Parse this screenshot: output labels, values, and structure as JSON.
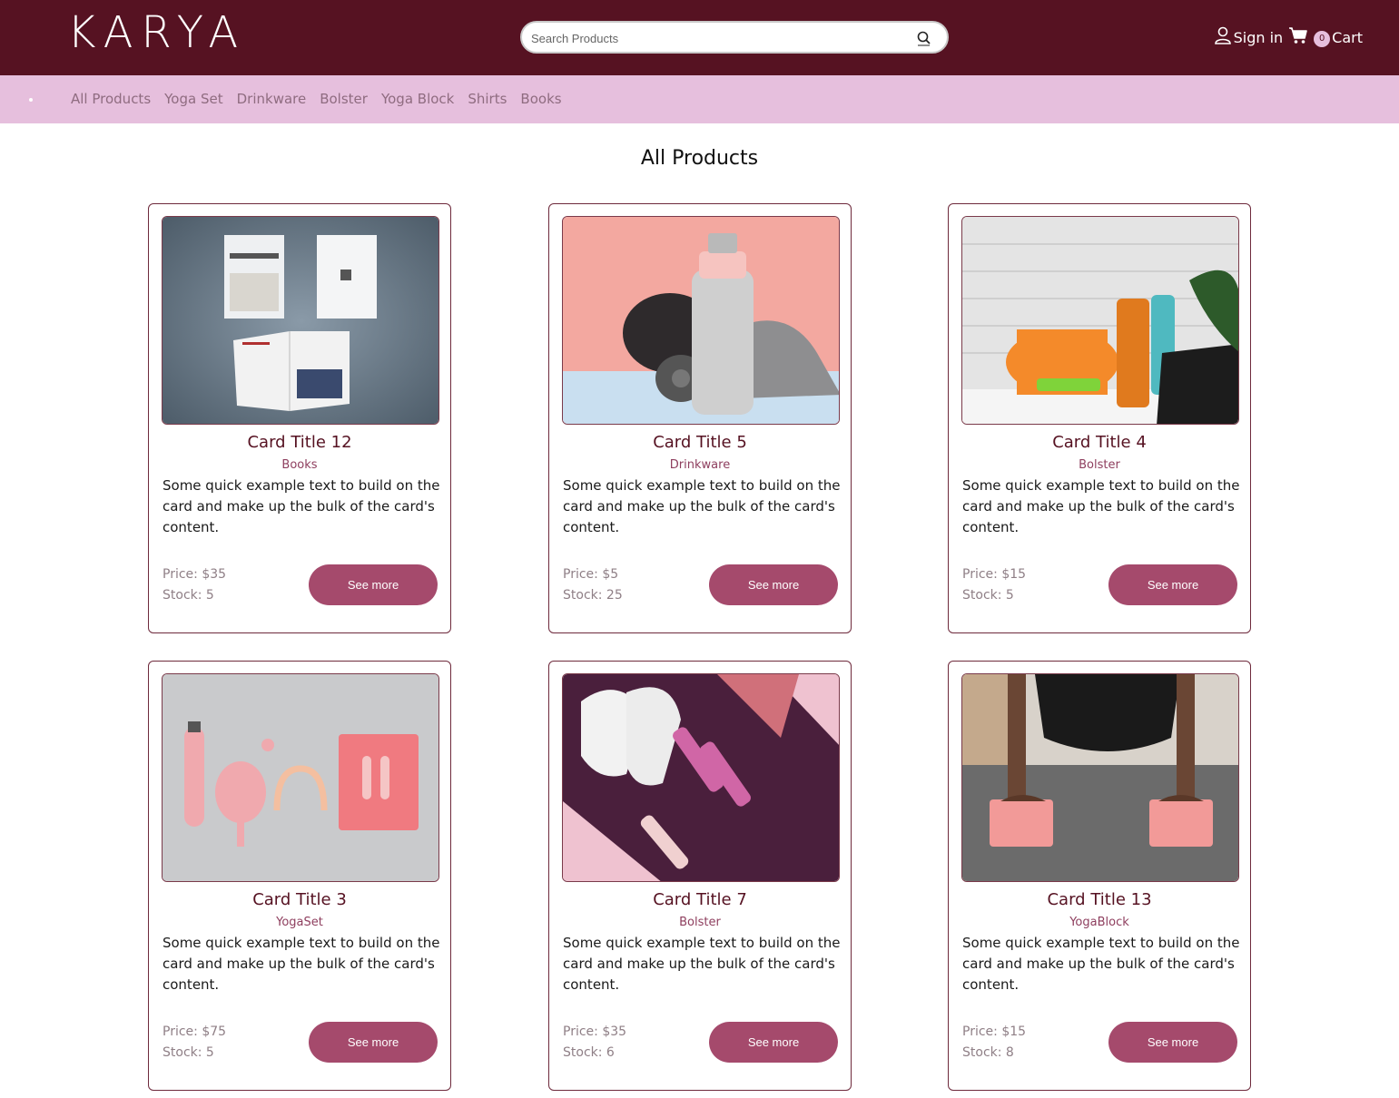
{
  "brand": {
    "logo": "KARYA"
  },
  "search": {
    "placeholder": "Search Products"
  },
  "account": {
    "signin_label": "Sign in",
    "cart_count": "0",
    "cart_label": "Cart"
  },
  "categories": [
    "All Products",
    "Yoga Set",
    "Drinkware",
    "Bolster",
    "Yoga Block",
    "Shirts",
    "Books"
  ],
  "page": {
    "title": "All Products"
  },
  "colors": {
    "header": "#561222",
    "nav": "#e6bfdd",
    "button": "#a54a6c",
    "title_text": "#561222"
  },
  "products": [
    {
      "title": "Card Title 12",
      "category": "Books",
      "description": "Some quick example text to build on the card and make up the bulk of the card's content.",
      "price": "Price: $35",
      "stock": "Stock: 5",
      "button": "See more",
      "image": "books-photo"
    },
    {
      "title": "Card Title 5",
      "category": "Drinkware",
      "description": "Some quick example text to build on the card and make up the bulk of the card's content.",
      "price": "Price: $5",
      "stock": "Stock: 25",
      "button": "See more",
      "image": "water-bottle-photo"
    },
    {
      "title": "Card Title 4",
      "category": "Bolster",
      "description": "Some quick example text to build on the card and make up the bulk of the card's content.",
      "price": "Price: $15",
      "stock": "Stock: 5",
      "button": "See more",
      "image": "fitness-gear-photo"
    },
    {
      "title": "Card Title 3",
      "category": "YogaSet",
      "description": "Some quick example text to build on the card and make up the bulk of the card's content.",
      "price": "Price: $75",
      "stock": "Stock: 5",
      "button": "See more",
      "image": "pink-set-photo"
    },
    {
      "title": "Card Title 7",
      "category": "Bolster",
      "description": "Some quick example text to build on the card and make up the bulk of the card's content.",
      "price": "Price: $35",
      "stock": "Stock: 6",
      "button": "See more",
      "image": "sneakers-dumbbells-photo"
    },
    {
      "title": "Card Title 13",
      "category": "YogaBlock",
      "description": "Some quick example text to build on the card and make up the bulk of the card's content.",
      "price": "Price: $15",
      "stock": "Stock: 8",
      "button": "See more",
      "image": "yoga-blocks-photo"
    }
  ]
}
